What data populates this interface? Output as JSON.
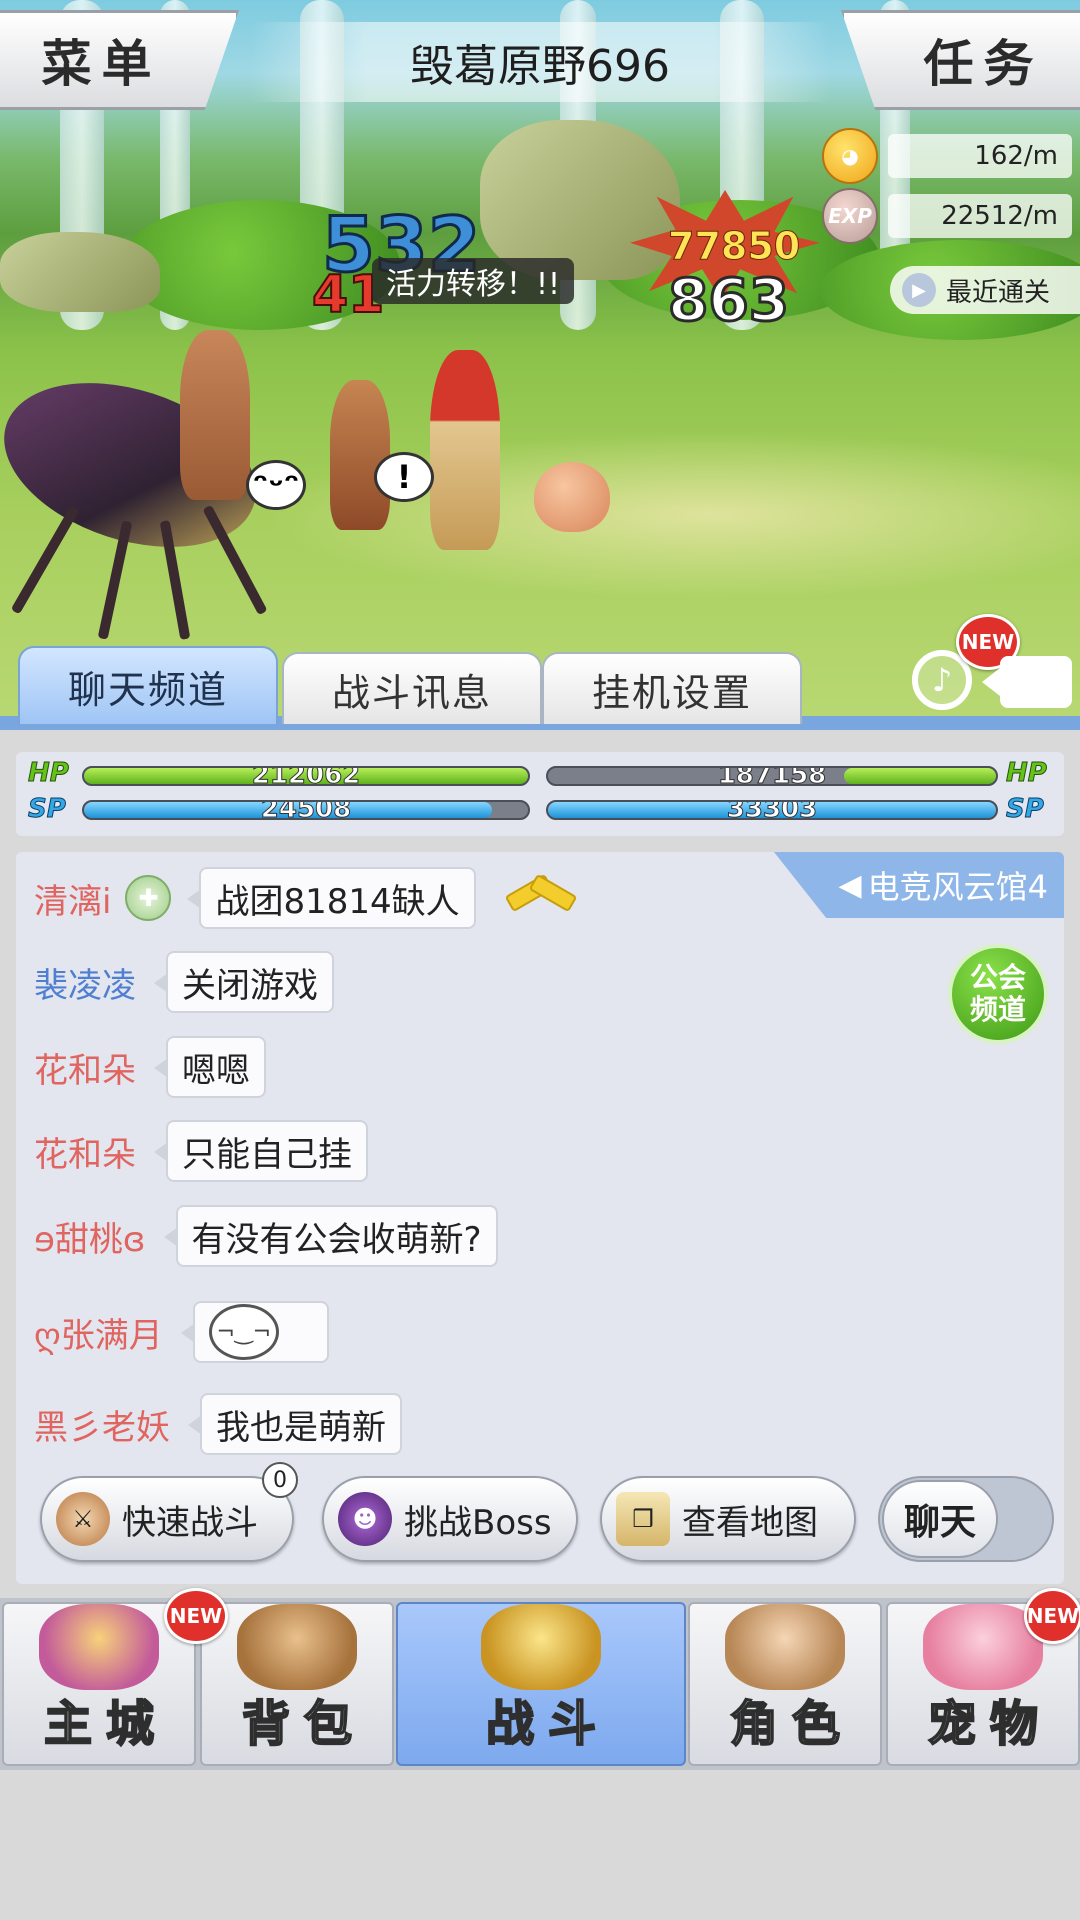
{
  "header": {
    "menu_label": "菜单",
    "map_title": "毁葛原野696",
    "task_label": "任务"
  },
  "rates": {
    "coin": "162/m",
    "exp_icon_text": "EXP",
    "exp": "22512/m",
    "recent_label": "最近通关"
  },
  "battle": {
    "damage_blue": "532",
    "damage_red": "41",
    "skill_text": "活力转移！!!",
    "damage_yellow": "77850",
    "damage_white": "863",
    "emote_text": "!"
  },
  "scene_tabs": [
    {
      "label": "聊天频道",
      "active": true
    },
    {
      "label": "战斗讯息",
      "active": false
    },
    {
      "label": "挂机设置",
      "active": false
    }
  ],
  "new_badge": "NEW",
  "status": {
    "hp_label": "HP",
    "sp_label": "SP",
    "player_hp": "212062",
    "player_hp_fraction": 1.0,
    "player_sp": "24508",
    "player_sp_fraction": 0.92,
    "enemy_hp": "187158",
    "enemy_hp_fraction": 0.34,
    "enemy_sp": "33303",
    "enemy_sp_fraction": 1.0
  },
  "chat": {
    "channel": "电竞风云馆4",
    "guild_button": "公会频道",
    "messages": [
      {
        "name": "清漓i",
        "text": "战团81814缺人",
        "name_color": "#e0645f"
      },
      {
        "name": "裴凌凌",
        "text": "关闭游戏",
        "name_color": "#4f7fd0"
      },
      {
        "name": "花和朵",
        "text": "嗯嗯",
        "name_color": "#e0645f"
      },
      {
        "name": "花和朵",
        "text": "只能自己挂",
        "name_color": "#e0645f"
      },
      {
        "name": "ɘ甜桃ɞ",
        "text": "有没有公会收萌新?",
        "name_color": "#e0645f"
      },
      {
        "name": "ღ张满月",
        "text": "",
        "name_color": "#e0645f"
      },
      {
        "name": "黑彡老妖",
        "text": "我也是萌新",
        "name_color": "#e0645f"
      }
    ]
  },
  "actions": {
    "quick_battle": "快速战斗",
    "quick_battle_count": "0",
    "boss": "挑战Boss",
    "map": "查看地图",
    "chat_toggle": "聊天"
  },
  "nav": [
    {
      "label": "主城",
      "new": true,
      "active": false
    },
    {
      "label": "背包",
      "new": false,
      "active": false
    },
    {
      "label": "战斗",
      "new": false,
      "active": true
    },
    {
      "label": "角色",
      "new": false,
      "active": false
    },
    {
      "label": "宠物",
      "new": true,
      "active": false
    }
  ]
}
